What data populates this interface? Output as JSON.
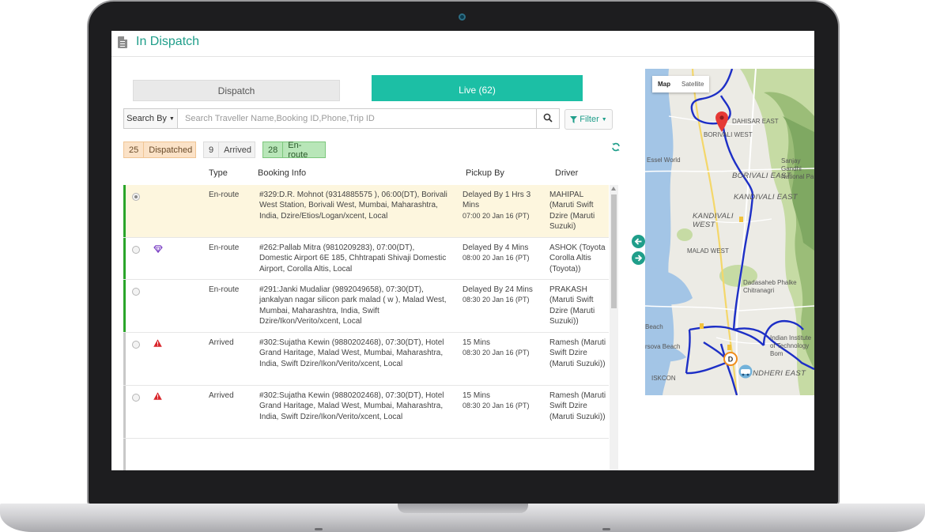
{
  "app": {
    "title": "In Dispatch"
  },
  "tabs": {
    "dispatch": "Dispatch",
    "live": "Live (62)"
  },
  "search": {
    "by_label": "Search By",
    "placeholder": "Search Traveller Name,Booking ID,Phone,Trip ID",
    "value": ""
  },
  "filter": {
    "label": "Filter"
  },
  "status": {
    "dispatched": {
      "count": "25",
      "label": "Dispatched"
    },
    "arrived": {
      "count": "9",
      "label": "Arrived"
    },
    "enroute": {
      "count": "28",
      "label": "En-route"
    }
  },
  "columns": {
    "type": "Type",
    "booking": "Booking Info",
    "pickup": "Pickup By",
    "driver": "Driver"
  },
  "rows": [
    {
      "type": "En-route",
      "booking": "#329:D.R. Mohnot (9314885575 ), 06:00(DT), Borivali West Station, Borivali West, Mumbai, Maharashtra, India, Dzire/Etios/Logan/xcent, Local",
      "pickup_status": "Delayed By 1 Hrs 3 Mins",
      "pickup_time": "07:00 20 Jan 16 (PT)",
      "driver": "MAHIPAL (Maruti Swift Dzire (Maruti Suzuki)",
      "icon": "",
      "selected": true
    },
    {
      "type": "En-route",
      "booking": "#262:Pallab Mitra (9810209283), 07:00(DT), Domestic Airport 6E 185, Chhtrapati Shivaji Domestic Airport, Corolla Altis, Local",
      "pickup_status": "Delayed By 4 Mins",
      "pickup_time": "08:00 20 Jan 16 (PT)",
      "driver": "ASHOK (Toyota Corolla Altis (Toyota))",
      "icon": "diamond-icon",
      "selected": false
    },
    {
      "type": "En-route",
      "booking": "#291:Janki Mudaliar (9892049658), 07:30(DT), jankalyan nagar silicon park malad ( w ), Malad West, Mumbai, Maharashtra, India, Swift Dzire/Ikon/Verito/xcent, Local",
      "pickup_status": "Delayed By 24 Mins",
      "pickup_time": "08:30 20 Jan 16 (PT)",
      "driver": "PRAKASH (Maruti Swift Dzire (Maruti Suzuki))",
      "icon": "",
      "selected": false
    },
    {
      "type": "Arrived",
      "booking": "#302:Sujatha Kewin (9880202468), 07:30(DT), Hotel Grand Haritage, Malad West, Mumbai, Maharashtra, India, Swift Dzire/Ikon/Verito/xcent, Local",
      "pickup_status": "15 Mins",
      "pickup_time": "08:30 20 Jan 16 (PT)",
      "driver": "Ramesh (Maruti Swift Dzire (Maruti Suzuki))",
      "icon": "warning-icon",
      "selected": false
    },
    {
      "type": "Arrived",
      "booking": "#302:Sujatha Kewin (9880202468), 07:30(DT), Hotel Grand Haritage, Malad West, Mumbai, Maharashtra, India, Swift Dzire/Ikon/Verito/xcent, Local",
      "pickup_status": "15 Mins",
      "pickup_time": "08:30 20 Jan 16 (PT)",
      "driver": "Ramesh (Maruti Swift Dzire (Maruti Suzuki))",
      "icon": "warning-icon",
      "selected": false
    }
  ],
  "map": {
    "type_map": "Map",
    "type_satellite": "Satellite",
    "labels": {
      "dahisar_east": "DAHISAR EAST",
      "borivali_west": "BORIVALI WEST",
      "borivali_east": "BORIVALI EAST",
      "essel_world": "Essel World",
      "kandivali_east": "KANDIVALI EAST",
      "kandivali_west": "KANDIVALI WEST",
      "malad_west": "MALAD WEST",
      "phalke": "Dadasaheb Phalke Chitranagri",
      "sanjay_gandhi": "Sanjay Gandhi National Pa",
      "beach": "Beach",
      "versova_beach": "rsova Beach",
      "indian_institute": "Indian Institute of Technology Bom",
      "andheri_east": "NDHERI EAST",
      "iskcon": "ISKCON"
    }
  },
  "colors": {
    "accent": "#1cbfa5",
    "enroute": "#2aa52a",
    "arrived": "#c8c8c8",
    "warning": "#d9262c",
    "route": "#1d2fc6"
  }
}
